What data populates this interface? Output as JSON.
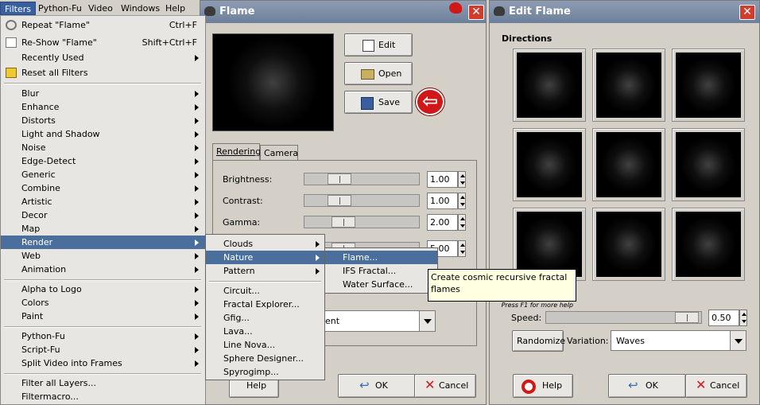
{
  "menubar": {
    "items": [
      "Filters",
      "Python-Fu",
      "Video",
      "Windows",
      "Help"
    ]
  },
  "filters_menu": {
    "repeat": {
      "label": "Repeat \"Flame\"",
      "shortcut": "Ctrl+F"
    },
    "reshow": {
      "label": "Re-Show \"Flame\"",
      "shortcut": "Shift+Ctrl+F"
    },
    "recently_used": "Recently Used",
    "reset_all": "Reset all Filters",
    "group1": [
      "Blur",
      "Enhance",
      "Distorts",
      "Light and Shadow",
      "Noise",
      "Edge-Detect",
      "Generic",
      "Combine",
      "Artistic",
      "Decor",
      "Map",
      "Render",
      "Web",
      "Animation"
    ],
    "group2": [
      "Alpha to Logo",
      "Colors",
      "Paint"
    ],
    "group3": [
      "Python-Fu",
      "Script-Fu",
      "Split Video into Frames"
    ],
    "group4": [
      "Filter all Layers...",
      "Filtermacro..."
    ]
  },
  "render_submenu": {
    "groups": [
      "Clouds",
      "Nature",
      "Pattern"
    ],
    "items": [
      "Circuit...",
      "Fractal Explorer...",
      "Gfig...",
      "Lava...",
      "Line Nova...",
      "Sphere Designer...",
      "Spyrogimp..."
    ]
  },
  "nature_submenu": {
    "items": [
      "Flame...",
      "IFS Fractal...",
      "Water Surface..."
    ]
  },
  "tooltip": {
    "text": "Create cosmic recursive fractal flames",
    "hint": "Press F1 for more help"
  },
  "flame_window": {
    "title": "Flame",
    "buttons": {
      "edit": "Edit",
      "open": "Open",
      "save": "Save"
    },
    "tabs": [
      "Rendering",
      "Camera"
    ],
    "params": [
      {
        "label": "Brightness:",
        "value": "1.00"
      },
      {
        "label": "Contrast:",
        "value": "1.00"
      },
      {
        "label": "Gamma:",
        "value": "2.00"
      },
      {
        "label": "",
        "value": "5.00"
      }
    ],
    "slider_levels": [
      0.25,
      0.25,
      0.3,
      0.3
    ],
    "gradient_combo": "dient",
    "help": "Help",
    "ok": "OK",
    "cancel": "Cancel"
  },
  "edit_flame_window": {
    "title": "Edit Flame",
    "directions_label": "Directions",
    "speed_label": "Speed:",
    "speed_value": "0.50",
    "speed_level": 0.98,
    "randomize": "Randomize",
    "variation_label": "Variation:",
    "variation_value": "Waves",
    "help": "Help",
    "ok": "OK",
    "cancel": "Cancel"
  },
  "colors": {
    "menu_highlight": "#4a6f9d",
    "titlebar": "#7d8ea8",
    "close_button": "#d23c2c",
    "tooltip_bg": "#ffffe1",
    "arrow_red": "#d01818"
  }
}
